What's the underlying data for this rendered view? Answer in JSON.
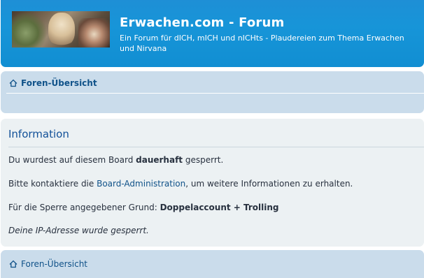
{
  "header": {
    "title": "Erwachen.com - Forum",
    "description": "Ein Forum für dICH, mICH und nICHts - Plaudereien zum Thema Erwachen und Nirvana",
    "logo_icon": "buddha-logo-image",
    "background_color": "#1795d8"
  },
  "navbar": {
    "breadcrumb_label": "Foren-Übersicht",
    "icon": "home-icon"
  },
  "info_panel": {
    "heading": "Information",
    "line1_prefix": "Du wurdest auf diesem Board ",
    "line1_emphasis": "dauerhaft",
    "line1_suffix": " gesperrt.",
    "line2_prefix": "Bitte kontaktiere die ",
    "line2_link": "Board-Administration",
    "line2_suffix": ", um weitere Informationen zu erhalten.",
    "line3_prefix": "Für die Sperre angegebener Grund: ",
    "line3_reason": "Doppelaccount + Trolling",
    "line4": "Deine IP-Adresse wurde gesperrt."
  },
  "footer_nav": {
    "breadcrumb_label": "Foren-Übersicht",
    "icon": "home-icon"
  },
  "colors": {
    "link": "#105289",
    "heading": "#115098",
    "nav_bg": "#cadceb",
    "panel_bg": "#ecf1f3"
  }
}
